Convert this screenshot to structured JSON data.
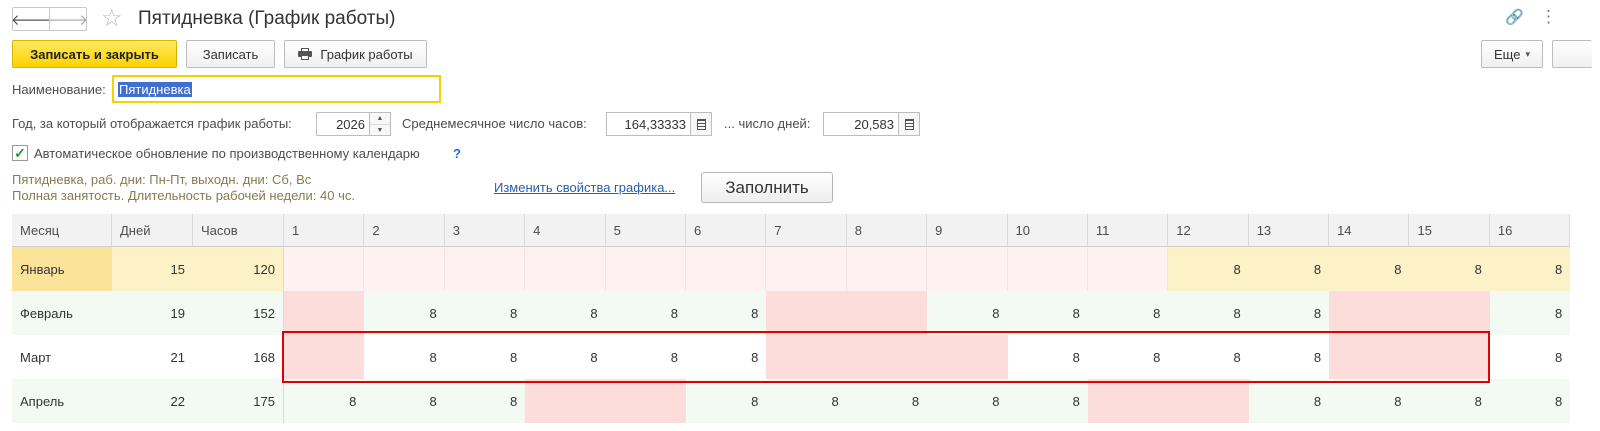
{
  "window": {
    "title": "Пятидневка (График работы)",
    "back_glyph": "🡐",
    "forward_glyph": "🡒",
    "star_glyph": "☆",
    "link_glyph": "🔗",
    "menu_glyph": "⋮"
  },
  "toolbar": {
    "save_close": "Записать и закрыть",
    "save": "Записать",
    "schedule": "График работы",
    "more": "Еще",
    "more_arrow": "▾"
  },
  "form": {
    "name_label": "Наименование:",
    "name_value": "Пятидневка",
    "year_label": "Год, за который отображается график работы:",
    "year_value": "2026",
    "avg_hours_label": "Среднемесячное число часов:",
    "avg_hours_value": "164,33333",
    "days_label": "... число дней:",
    "days_value": "20,583",
    "auto_update_label": "Автоматическое обновление по производственному календарю",
    "auto_update_checked": true,
    "help": "?",
    "info_line1": "Пятидневка, раб. дни: Пн-Пт, выходн. дни: Сб, Вс",
    "info_line2": "Полная занятость. Длительность рабочей недели: 40 чс.",
    "change_link": "Изменить свойства графика...",
    "fill_button": "Заполнить"
  },
  "table": {
    "headers": [
      "Месяц",
      "Дней",
      "Часов",
      "1",
      "2",
      "3",
      "4",
      "5",
      "6",
      "7",
      "8",
      "9",
      "10",
      "11",
      "12",
      "13",
      "14",
      "15",
      "16"
    ],
    "rows": [
      {
        "month": "Январь",
        "days": "15",
        "hours": "120",
        "cells": [
          "",
          "",
          "",
          "",
          "",
          "",
          "",
          "",
          "",
          "",
          "",
          "8",
          "8",
          "8",
          "8",
          "8"
        ],
        "weekend": []
      },
      {
        "month": "Февраль",
        "days": "19",
        "hours": "152",
        "cells": [
          "",
          "8",
          "8",
          "8",
          "8",
          "8",
          "",
          "",
          "8",
          "8",
          "8",
          "8",
          "8",
          "",
          "",
          "8"
        ],
        "weekend": [
          1,
          7,
          8,
          14,
          15
        ]
      },
      {
        "month": "Март",
        "days": "21",
        "hours": "168",
        "cells": [
          "",
          "8",
          "8",
          "8",
          "8",
          "8",
          "",
          "",
          "",
          "8",
          "8",
          "8",
          "8",
          "",
          "",
          "8"
        ],
        "weekend": [
          1,
          7,
          8,
          9,
          14,
          15
        ]
      },
      {
        "month": "Апрель",
        "days": "22",
        "hours": "175",
        "cells": [
          "8",
          "8",
          "8",
          "",
          "",
          "8",
          "8",
          "8",
          "8",
          "8",
          "",
          "",
          "8",
          "8",
          "8",
          "8"
        ],
        "weekend": [
          4,
          5,
          11,
          12
        ]
      }
    ]
  },
  "colors": {
    "accent": "#fbd200",
    "weekend": "#fddcdc",
    "holiday_light": "#fdf1f1",
    "january": "#fdf1c8",
    "january_month": "#fbe49a",
    "highlight": "#e00000",
    "link": "#2a5db0"
  }
}
